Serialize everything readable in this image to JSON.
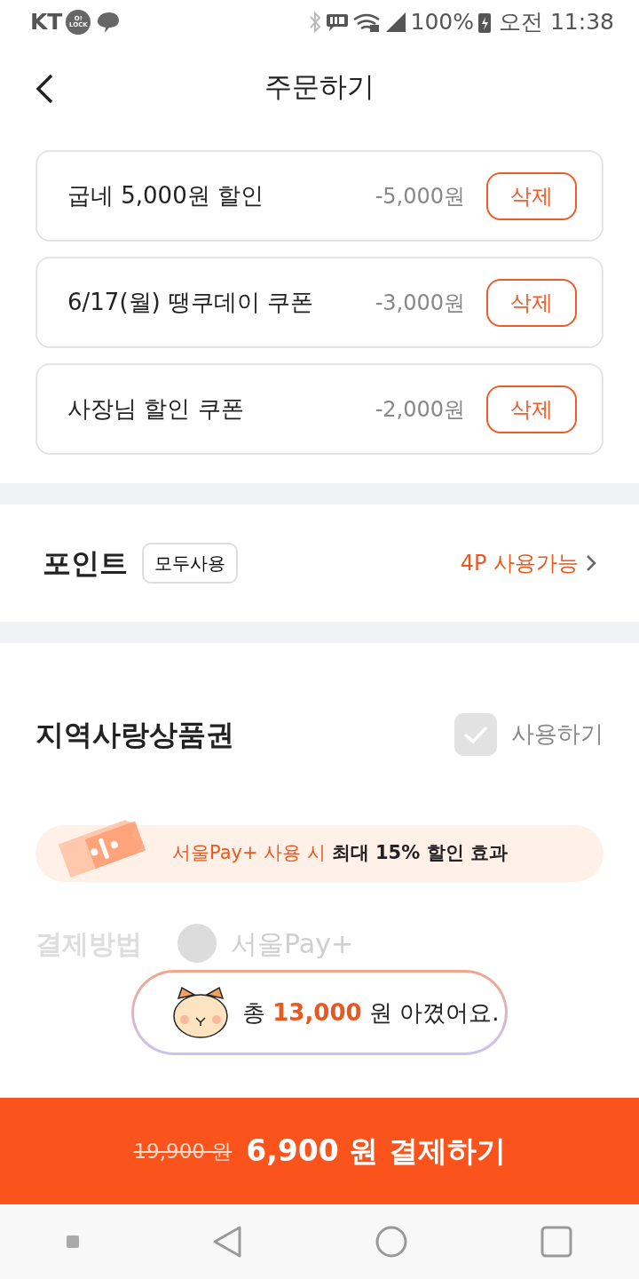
{
  "status_bar": {
    "carrier": "KT",
    "lock_badge": [
      "O!",
      "LOCK"
    ],
    "battery": "100%",
    "time": "오전 11:38"
  },
  "header": {
    "title": "주문하기"
  },
  "coupons": [
    {
      "name": "굽네 5,000원 할인",
      "amount": "-5,000원",
      "button": "삭제"
    },
    {
      "name": "6/17(월) 땡쿠데이 쿠폰",
      "amount": "-3,000원",
      "button": "삭제"
    },
    {
      "name": "사장님 할인 쿠폰",
      "amount": "-2,000원",
      "button": "삭제"
    }
  ],
  "points": {
    "title": "포인트",
    "use_all": "모두사용",
    "available": "4P 사용가능"
  },
  "gift_card": {
    "title": "지역사랑상품권",
    "checkbox_label": "사용하기",
    "checked": true,
    "disabled": true,
    "banner": "서울Pay+ 사용 시 **최대 15% 할인 효과**",
    "payment_label": "결제방법",
    "payment_option": "서울Pay+"
  },
  "toast": {
    "parts": [
      "총 ",
      "13,000",
      " 원 아꼈어요."
    ]
  },
  "pay_bar": {
    "original_price": "19,900 원",
    "label": "6,900 원 결제하기"
  }
}
